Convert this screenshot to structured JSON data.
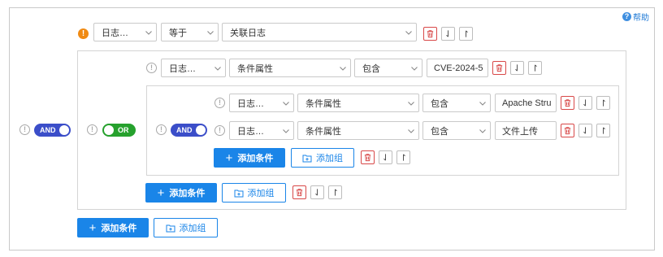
{
  "help": {
    "label": "帮助"
  },
  "toggles": {
    "and": "AND",
    "or": "OR"
  },
  "top_row": {
    "field": "日志…",
    "operator": "等于",
    "value": "关联日志"
  },
  "or_row": {
    "field": "日志…",
    "attribute": "条件属性",
    "operator": "包含",
    "value": "CVE-2024-5"
  },
  "inner_row1": {
    "field": "日志…",
    "attribute": "条件属性",
    "operator": "包含",
    "value": "Apache Stru"
  },
  "inner_row2": {
    "field": "日志…",
    "attribute": "条件属性",
    "operator": "包含",
    "value": "文件上传"
  },
  "buttons": {
    "add_condition": "添加条件",
    "add_group": "添加组"
  },
  "icons": {
    "warning": "warning-icon",
    "info": "info-icon",
    "delete": "trash-icon",
    "move_down": "arrow-down-icon",
    "move_up": "arrow-up-icon",
    "chevron": "chevron-down-icon",
    "folder": "folder-add-icon"
  },
  "colors": {
    "primary": "#1a85e8",
    "and_toggle": "#3b4ec9",
    "or_toggle": "#26a12d",
    "warning": "#f08a12",
    "delete": "#d84848"
  }
}
